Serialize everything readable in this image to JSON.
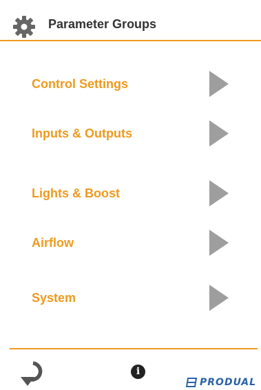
{
  "header": {
    "title": "Parameter Groups",
    "icon": "gear-icon"
  },
  "menu": {
    "items": [
      {
        "label": "Control Settings"
      },
      {
        "label": "Inputs & Outputs"
      },
      {
        "label": "Lights & Boost"
      },
      {
        "label": "Airflow"
      },
      {
        "label": "System"
      }
    ]
  },
  "footer": {
    "refresh_icon": "refresh-icon",
    "info_glyph": "i",
    "logo_text": "PRODUAL"
  },
  "colors": {
    "accent": "#ee9a1e",
    "arrow": "#9e9e9e",
    "title": "#333333",
    "brand": "#2b62a8"
  }
}
